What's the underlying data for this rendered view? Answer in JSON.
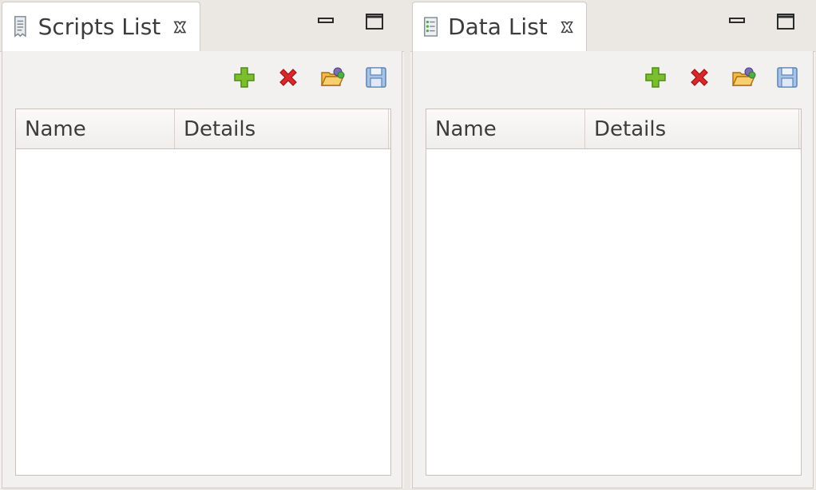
{
  "panels": [
    {
      "tab": {
        "label": "Scripts List",
        "icon": "script-document-icon"
      },
      "table": {
        "columns": [
          "Name",
          "Details"
        ],
        "rows": []
      }
    },
    {
      "tab": {
        "label": "Data List",
        "icon": "data-list-icon"
      },
      "table": {
        "columns": [
          "Name",
          "Details"
        ],
        "rows": []
      }
    }
  ],
  "toolbar": {
    "icons": [
      "add-icon",
      "delete-icon",
      "open-folder-icon",
      "save-icon"
    ]
  },
  "colors": {
    "add": "#7cbf2e",
    "delete": "#d9282b",
    "folder": "#e9a93a",
    "save": "#6f9bd1"
  }
}
